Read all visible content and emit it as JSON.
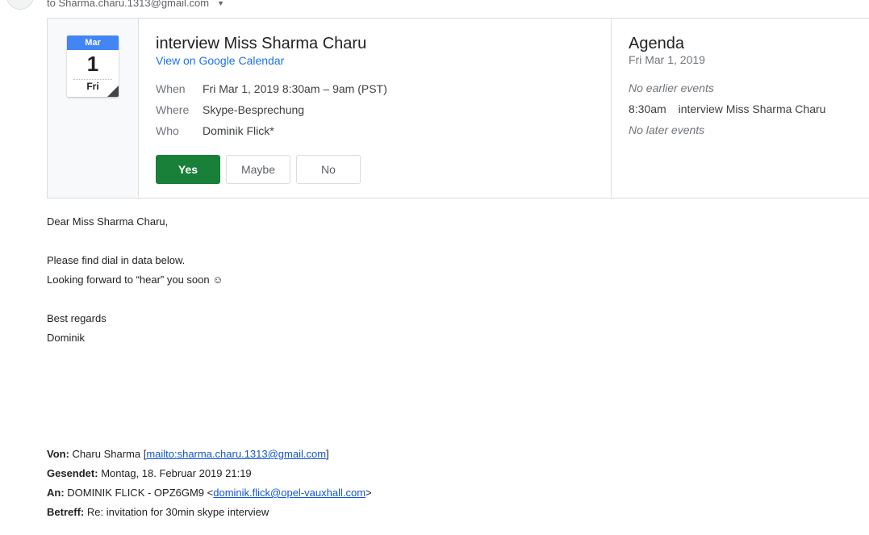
{
  "recipient": {
    "to_text": "to Sharma.charu.1313@gmail.com"
  },
  "calendar_icon": {
    "month": "Mar",
    "day": "1",
    "weekday": "Fri"
  },
  "event": {
    "title": "interview Miss Sharma Charu",
    "link": "View on Google Calendar",
    "when_label": "When",
    "when_value": "Fri Mar 1, 2019 8:30am – 9am (PST)",
    "where_label": "Where",
    "where_value": "Skype-Besprechung",
    "who_label": "Who",
    "who_value": "Dominik Flick*",
    "rsvp": {
      "yes": "Yes",
      "maybe": "Maybe",
      "no": "No"
    }
  },
  "agenda": {
    "title": "Agenda",
    "date": "Fri Mar 1, 2019",
    "no_earlier": "No earlier events",
    "event_time": "8:30am",
    "event_title": "interview Miss Sharma Charu",
    "no_later": "No later events"
  },
  "message": {
    "greeting": "Dear Miss Sharma Charu,",
    "line1": "Please find dial in data below.",
    "line2": "Looking forward to “hear” you soon ☺",
    "closing": "Best regards",
    "signature": "Dominik"
  },
  "quoted_headers": {
    "von_label": "Von:",
    "von_name": "Charu Sharma [",
    "von_link": "mailto:sharma.charu.1313@gmail.com",
    "von_end": "]",
    "gesendet_label": "Gesendet:",
    "gesendet_value": "Montag, 18. Februar 2019 21:19",
    "an_label": "An:",
    "an_name": "DOMINIK FLICK - OPZ6GM9 <",
    "an_link": "dominik.flick@opel-vauxhall.com",
    "an_end": ">",
    "betreff_label": "Betreff:",
    "betreff_value": "Re: invitation for 30min skype interview"
  }
}
